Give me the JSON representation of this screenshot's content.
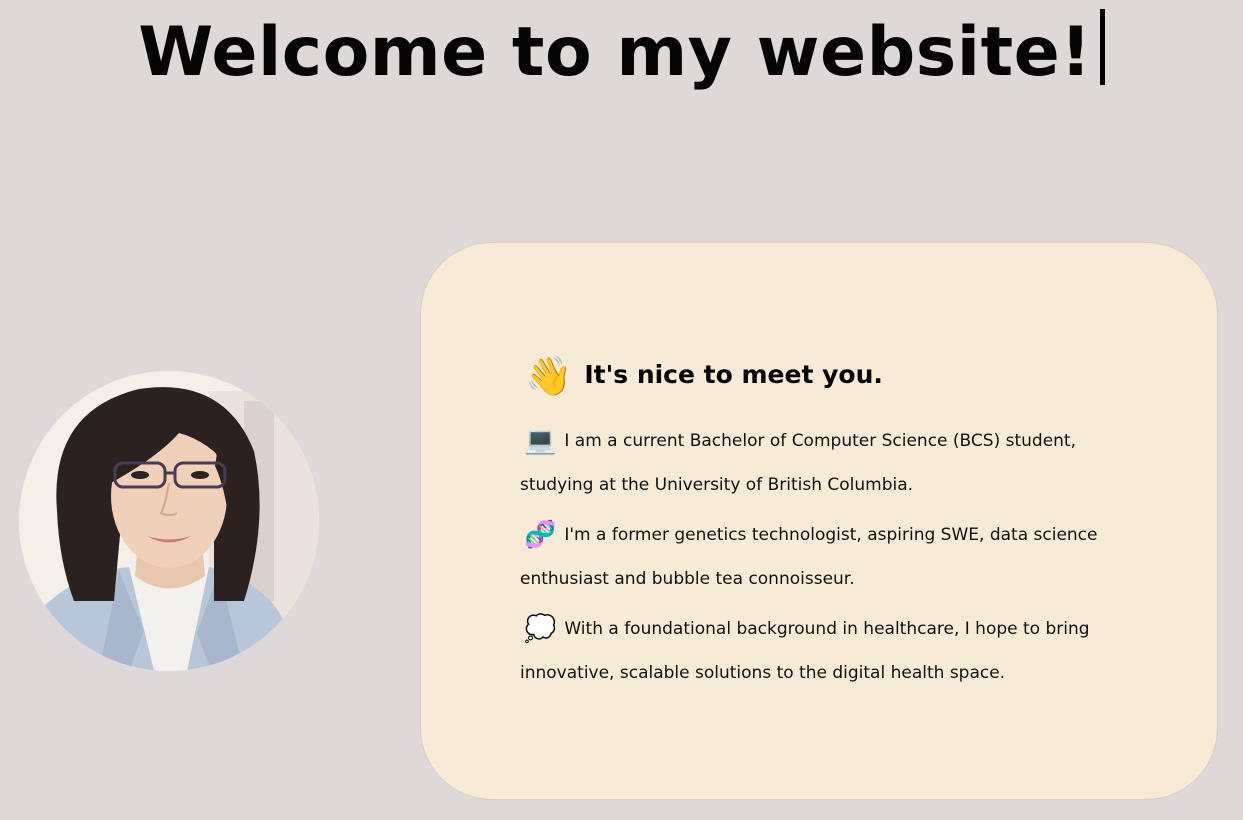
{
  "header": {
    "title": "Welcome to my website!"
  },
  "profile": {
    "avatar_alt": "Profile photo"
  },
  "intro_card": {
    "greeting": "It's nice to meet you.",
    "greeting_icon": "waving-hand-icon",
    "paragraphs": [
      {
        "icon": "laptop-icon",
        "text": "I am a current Bachelor of Computer Science (BCS) student, studying at the University of British Columbia."
      },
      {
        "icon": "dna-icon",
        "text": "I'm a former genetics technologist, aspiring SWE, data science enthusiast and bubble tea connoisseur."
      },
      {
        "icon": "thought-bubble-icon",
        "text": "With a foundational background in healthcare, I hope to bring innovative, scalable solutions to the digital health space."
      }
    ]
  },
  "colors": {
    "background": "#ded8d8",
    "card_background": "#f7ead6",
    "text": "#000000"
  }
}
